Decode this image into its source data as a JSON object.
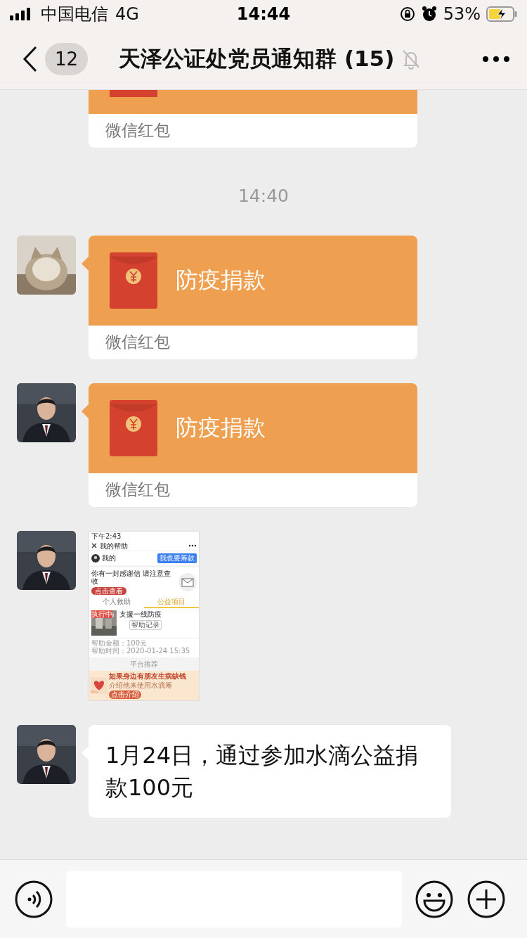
{
  "status_bar": {
    "carrier": "中国电信",
    "network": "4G",
    "time": "14:44",
    "battery": "53%"
  },
  "nav": {
    "back_count": "12",
    "title": "天泽公证处党员通知群 (15)",
    "muted": true
  },
  "messages": [
    {
      "kind": "red_packet",
      "cut": true,
      "label": "微信红包"
    },
    {
      "kind": "time",
      "text": "14:40"
    },
    {
      "kind": "red_packet",
      "avatar": true,
      "title": "防疫捐款",
      "label": "微信红包"
    },
    {
      "kind": "red_packet",
      "avatar": true,
      "title": "防疫捐款",
      "label": "微信红包"
    },
    {
      "kind": "screenshot",
      "avatar": true,
      "shot": {
        "time": "下午2:43",
        "title": "我的帮助",
        "me": "我的",
        "raise_button": "我也要筹款",
        "letter": "你有一封感谢信 请注意查收",
        "view_button": "点击查看",
        "tabs": [
          {
            "label": "个人救助",
            "selected": false
          },
          {
            "label": "公益项目",
            "selected": true
          }
        ],
        "project": {
          "badge": "执行中",
          "name": "支援一线防疫",
          "record_button": "帮助记录"
        },
        "details": [
          "帮助金额：100元",
          "帮助时间：2020-01-24 15:35"
        ],
        "recommend": "平台推荐",
        "banner": {
          "headline": "如果身边有朋友生病缺钱",
          "sub": "介绍他来使用水滴筹",
          "button": "点击介绍"
        }
      }
    },
    {
      "kind": "text",
      "avatar": true,
      "text": "1月24日，通过参加水滴公益捐款100元"
    }
  ]
}
